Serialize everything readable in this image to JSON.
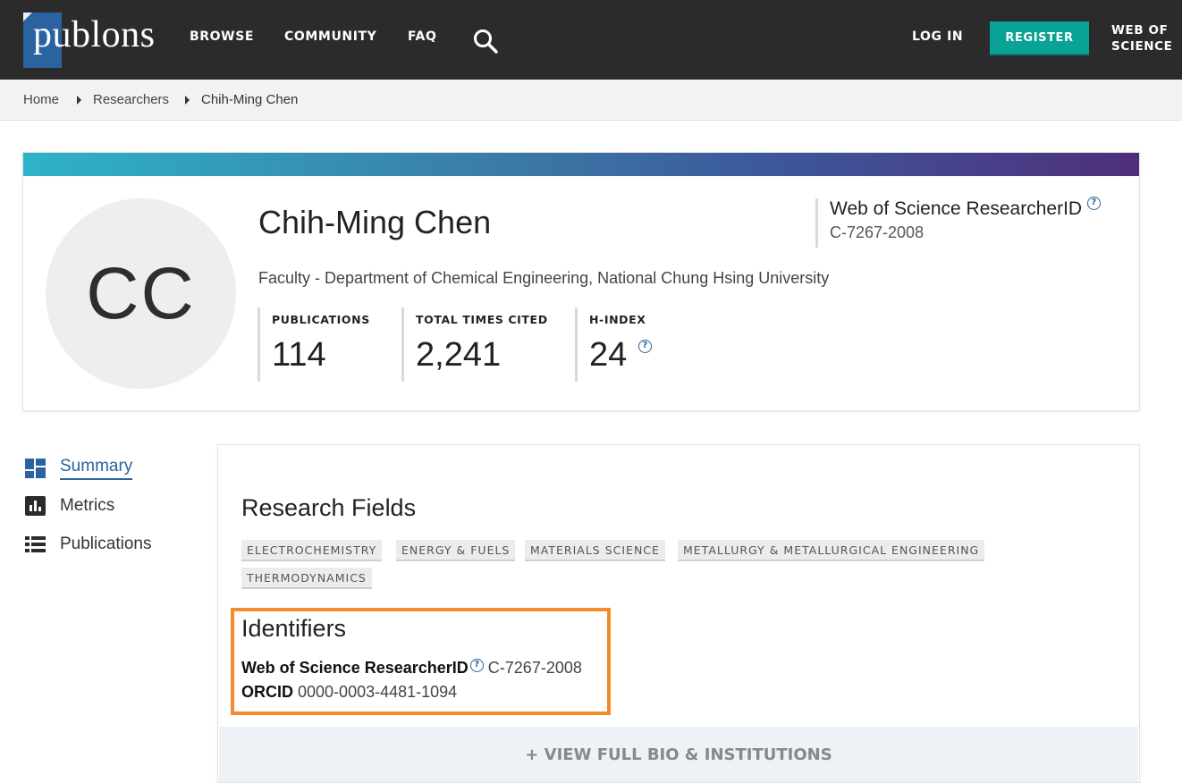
{
  "nav": {
    "logo": "publons",
    "browse": "BROWSE",
    "community": "COMMUNITY",
    "faq": "FAQ",
    "login": "LOG IN",
    "register": "REGISTER",
    "wos_line1": "WEB OF",
    "wos_line2": "SCIENCE"
  },
  "breadcrumb": {
    "home": "Home",
    "researchers": "Researchers",
    "current": "Chih-Ming Chen"
  },
  "profile": {
    "initials": "CC",
    "name": "Chih-Ming Chen",
    "position": "Faculty - Department of Chemical Engineering, National Chung Hsing University",
    "researcher_id_label": "Web of Science ResearcherID",
    "researcher_id": "C-7267-2008",
    "stats": {
      "publications_label": "PUBLICATIONS",
      "publications": "114",
      "times_cited_label": "TOTAL TIMES CITED",
      "times_cited": "2,241",
      "h_index_label": "H-INDEX",
      "h_index": "24"
    }
  },
  "sidebar": {
    "items": [
      {
        "label": "Summary",
        "icon": "dashboard-icon",
        "active": true
      },
      {
        "label": "Metrics",
        "icon": "bar-chart-icon",
        "active": false
      },
      {
        "label": "Publications",
        "icon": "list-icon",
        "active": false
      }
    ]
  },
  "main": {
    "research_fields_title": "Research Fields",
    "fields": [
      "ELECTROCHEMISTRY",
      "ENERGY & FUELS",
      "MATERIALS SCIENCE",
      "METALLURGY & METALLURGICAL ENGINEERING",
      "THERMODYNAMICS"
    ],
    "identifiers_title": "Identifiers",
    "wos_id_label": "Web of Science ResearcherID",
    "wos_id_value": "C-7267-2008",
    "orcid_label": "ORCID",
    "orcid_value": "0000-0003-4481-1094",
    "view_bio": "+ VIEW FULL BIO & INSTITUTIONS"
  },
  "colors": {
    "nav_bg": "#2b2b2b",
    "logo_blue": "#2a63a0",
    "register_teal": "#0aa296",
    "highlight_orange": "#f58a2e"
  }
}
